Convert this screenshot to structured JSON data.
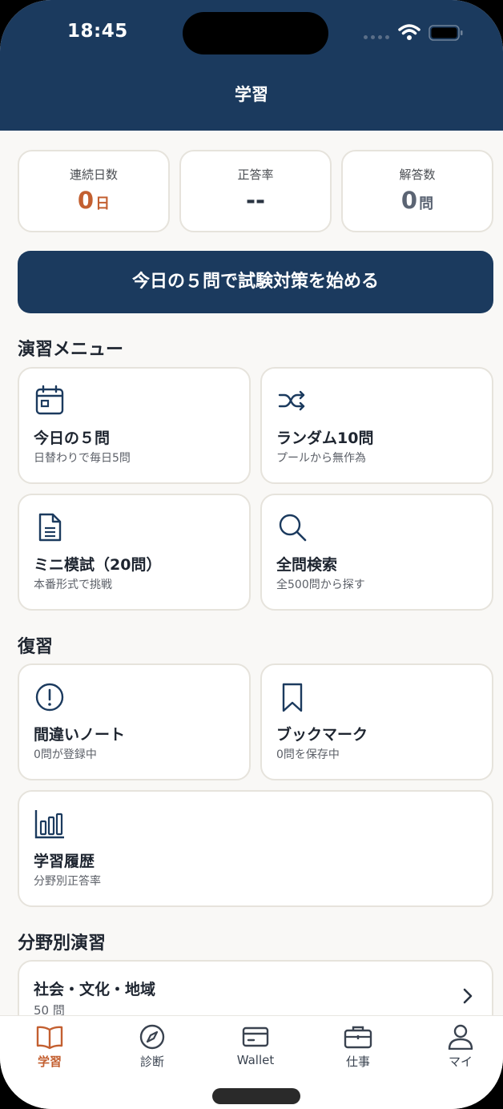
{
  "status_bar": {
    "time": "18:45"
  },
  "header": {
    "title": "学習"
  },
  "stats": [
    {
      "label": "連続日数",
      "value": "0",
      "unit": "日"
    },
    {
      "label": "正答率",
      "value": "--",
      "unit": ""
    },
    {
      "label": "解答数",
      "value": "0",
      "unit": "問"
    }
  ],
  "cta": {
    "label": "今日の５問で試験対策を始める"
  },
  "practice": {
    "title": "演習メニュー",
    "items": [
      {
        "title": "今日の５問",
        "sub": "日替わりで毎日5問",
        "icon": "calendar-icon"
      },
      {
        "title": "ランダム10問",
        "sub": "プールから無作為",
        "icon": "shuffle-icon"
      },
      {
        "title": "ミニ模試（20問）",
        "sub": "本番形式で挑戦",
        "icon": "document-icon"
      },
      {
        "title": "全問検索",
        "sub": "全500問から探す",
        "icon": "search-icon"
      }
    ]
  },
  "review": {
    "title": "復習",
    "items": [
      {
        "title": "間違いノート",
        "sub": "0問が登録中",
        "icon": "alert-circle-icon"
      },
      {
        "title": "ブックマーク",
        "sub": "0問を保存中",
        "icon": "bookmark-icon"
      },
      {
        "title": "学習履歴",
        "sub": "分野別正答率",
        "icon": "bar-chart-icon"
      }
    ]
  },
  "categories": {
    "title": "分野別演習",
    "items": [
      {
        "title": "社会・文化・地域",
        "count": "50 問"
      }
    ]
  },
  "tabbar": {
    "items": [
      {
        "label": "学習",
        "icon": "book-icon",
        "active": true
      },
      {
        "label": "診断",
        "icon": "compass-icon",
        "active": false
      },
      {
        "label": "Wallet",
        "icon": "card-icon",
        "active": false
      },
      {
        "label": "仕事",
        "icon": "briefcase-icon",
        "active": false
      },
      {
        "label": "マイ",
        "icon": "person-icon",
        "active": false
      }
    ]
  },
  "colors": {
    "navy": "#1b3a5e",
    "accent": "#c35f30",
    "background": "#f9f8f6",
    "card_border": "#e6e3dc"
  }
}
